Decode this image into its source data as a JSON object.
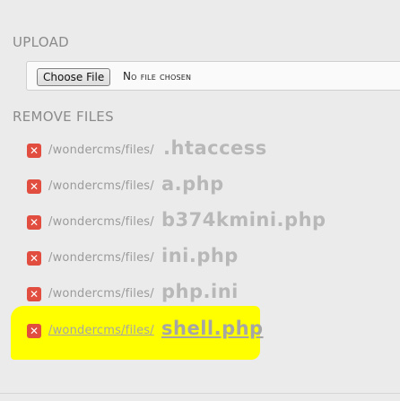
{
  "upload": {
    "title": "UPLOAD",
    "choose_button": "Choose File",
    "no_file_text": "No file chosen"
  },
  "remove": {
    "title": "REMOVE FILES",
    "files": [
      {
        "path": "/wondercms/files/",
        "name": ".htaccess"
      },
      {
        "path": "/wondercms/files/",
        "name": "a.php"
      },
      {
        "path": "/wondercms/files/",
        "name": "b374kmini.php"
      },
      {
        "path": "/wondercms/files/",
        "name": "ini.php"
      },
      {
        "path": "/wondercms/files/",
        "name": "php.ini"
      },
      {
        "path": "/wondercms/files/",
        "name": "shell.php"
      }
    ],
    "delete_glyph": "✕"
  },
  "colors": {
    "highlight": "#ffff00",
    "delete_button": "#e14d3e"
  },
  "icons": {
    "delete": "close-icon"
  }
}
